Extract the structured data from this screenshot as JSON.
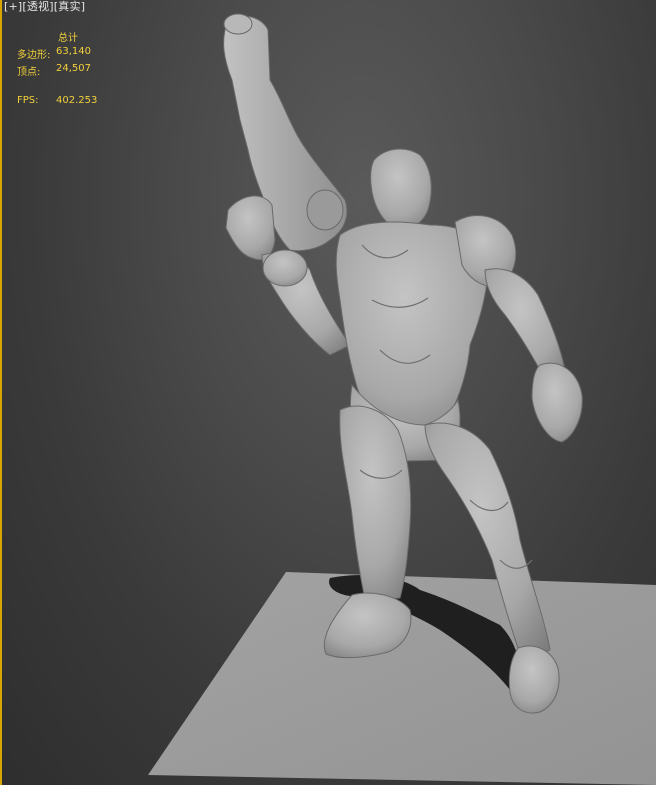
{
  "viewport": {
    "label_plus": "[+]",
    "label_view": "[透视]",
    "label_shading": "[真实]"
  },
  "stats": {
    "header": "总计",
    "polygons_label": "多边形:",
    "polygons_value": "63,140",
    "vertices_label": "顶点:",
    "vertices_value": "24,507",
    "fps_label": "FPS:",
    "fps_value": "402.253"
  },
  "colors": {
    "stats_text": "#f1cf3a",
    "active_border": "#d9a400",
    "ground_plane": "#9c9c9c",
    "model_gray": "#a9a9a9"
  },
  "scene": {
    "model": "character-model",
    "ground": "ground-plane"
  }
}
